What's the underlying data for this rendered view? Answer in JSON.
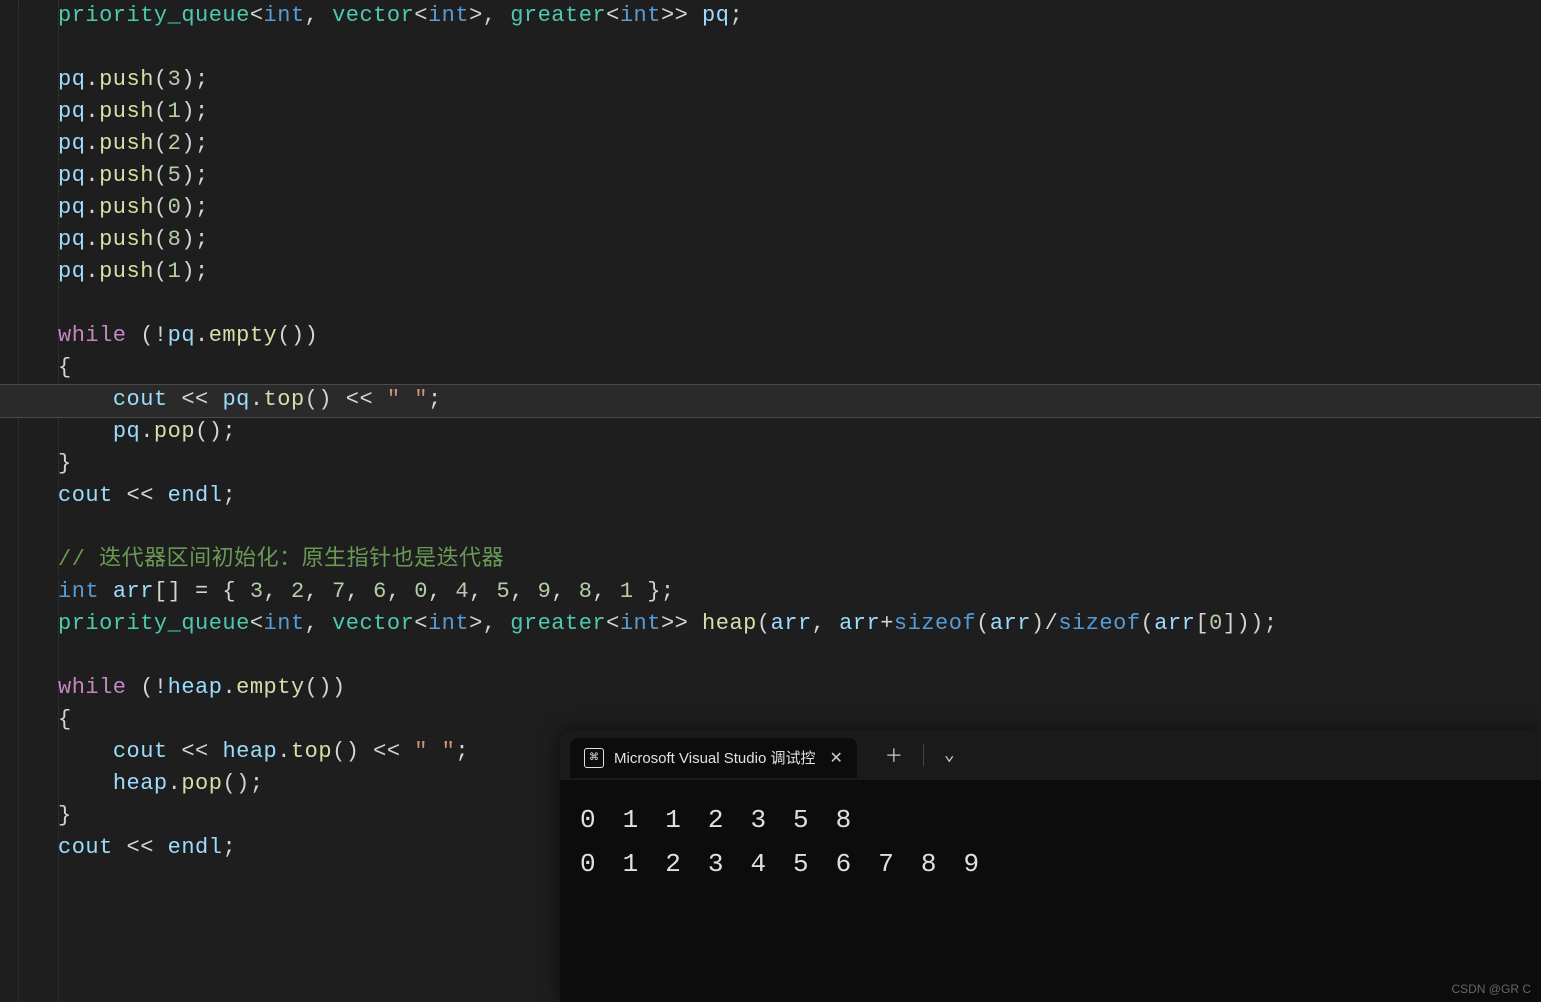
{
  "code_lines": [
    [
      {
        "cls": "t-type",
        "t": "priority_queue"
      },
      {
        "cls": "t-op",
        "t": "<"
      },
      {
        "cls": "t-key",
        "t": "int"
      },
      {
        "cls": "t-op",
        "t": ", "
      },
      {
        "cls": "t-type",
        "t": "vector"
      },
      {
        "cls": "t-op",
        "t": "<"
      },
      {
        "cls": "t-key",
        "t": "int"
      },
      {
        "cls": "t-op",
        "t": ">, "
      },
      {
        "cls": "t-type",
        "t": "greater"
      },
      {
        "cls": "t-op",
        "t": "<"
      },
      {
        "cls": "t-key",
        "t": "int"
      },
      {
        "cls": "t-op",
        "t": ">> "
      },
      {
        "cls": "t-var",
        "t": "pq"
      },
      {
        "cls": "t-op",
        "t": ";"
      }
    ],
    [],
    [
      {
        "cls": "t-var",
        "t": "pq"
      },
      {
        "cls": "t-op",
        "t": "."
      },
      {
        "cls": "t-fn",
        "t": "push"
      },
      {
        "cls": "t-op",
        "t": "("
      },
      {
        "cls": "t-num",
        "t": "3"
      },
      {
        "cls": "t-op",
        "t": ");"
      }
    ],
    [
      {
        "cls": "t-var",
        "t": "pq"
      },
      {
        "cls": "t-op",
        "t": "."
      },
      {
        "cls": "t-fn",
        "t": "push"
      },
      {
        "cls": "t-op",
        "t": "("
      },
      {
        "cls": "t-num",
        "t": "1"
      },
      {
        "cls": "t-op",
        "t": ");"
      }
    ],
    [
      {
        "cls": "t-var",
        "t": "pq"
      },
      {
        "cls": "t-op",
        "t": "."
      },
      {
        "cls": "t-fn",
        "t": "push"
      },
      {
        "cls": "t-op",
        "t": "("
      },
      {
        "cls": "t-num",
        "t": "2"
      },
      {
        "cls": "t-op",
        "t": ");"
      }
    ],
    [
      {
        "cls": "t-var",
        "t": "pq"
      },
      {
        "cls": "t-op",
        "t": "."
      },
      {
        "cls": "t-fn",
        "t": "push"
      },
      {
        "cls": "t-op",
        "t": "("
      },
      {
        "cls": "t-num",
        "t": "5"
      },
      {
        "cls": "t-op",
        "t": ");"
      }
    ],
    [
      {
        "cls": "t-var",
        "t": "pq"
      },
      {
        "cls": "t-op",
        "t": "."
      },
      {
        "cls": "t-fn",
        "t": "push"
      },
      {
        "cls": "t-op",
        "t": "("
      },
      {
        "cls": "t-num",
        "t": "0"
      },
      {
        "cls": "t-op",
        "t": ");"
      }
    ],
    [
      {
        "cls": "t-var",
        "t": "pq"
      },
      {
        "cls": "t-op",
        "t": "."
      },
      {
        "cls": "t-fn",
        "t": "push"
      },
      {
        "cls": "t-op",
        "t": "("
      },
      {
        "cls": "t-num",
        "t": "8"
      },
      {
        "cls": "t-op",
        "t": ");"
      }
    ],
    [
      {
        "cls": "t-var",
        "t": "pq"
      },
      {
        "cls": "t-op",
        "t": "."
      },
      {
        "cls": "t-fn",
        "t": "push"
      },
      {
        "cls": "t-op",
        "t": "("
      },
      {
        "cls": "t-num",
        "t": "1"
      },
      {
        "cls": "t-op",
        "t": ");"
      }
    ],
    [],
    [
      {
        "cls": "t-kw",
        "t": "while"
      },
      {
        "cls": "t-op",
        "t": " (!"
      },
      {
        "cls": "t-var",
        "t": "pq"
      },
      {
        "cls": "t-op",
        "t": "."
      },
      {
        "cls": "t-fn",
        "t": "empty"
      },
      {
        "cls": "t-op",
        "t": "())"
      }
    ],
    [
      {
        "cls": "t-op",
        "t": "{"
      }
    ],
    [
      {
        "cls": "t-op",
        "t": "    "
      },
      {
        "cls": "t-var",
        "t": "cout"
      },
      {
        "cls": "t-op",
        "t": " << "
      },
      {
        "cls": "t-var",
        "t": "pq"
      },
      {
        "cls": "t-op",
        "t": "."
      },
      {
        "cls": "t-fn",
        "t": "top"
      },
      {
        "cls": "t-op",
        "t": "() << "
      },
      {
        "cls": "t-str",
        "t": "\" \""
      },
      {
        "cls": "t-op",
        "t": ";"
      }
    ],
    [
      {
        "cls": "t-op",
        "t": "    "
      },
      {
        "cls": "t-var",
        "t": "pq"
      },
      {
        "cls": "t-op",
        "t": "."
      },
      {
        "cls": "t-fn",
        "t": "pop"
      },
      {
        "cls": "t-op",
        "t": "();"
      }
    ],
    [
      {
        "cls": "t-op",
        "t": "}"
      }
    ],
    [
      {
        "cls": "t-var",
        "t": "cout"
      },
      {
        "cls": "t-op",
        "t": " << "
      },
      {
        "cls": "t-var",
        "t": "endl"
      },
      {
        "cls": "t-op",
        "t": ";"
      }
    ],
    [],
    [
      {
        "cls": "t-com",
        "t": "// 迭代器区间初始化：原生指针也是迭代器"
      }
    ],
    [
      {
        "cls": "t-key",
        "t": "int"
      },
      {
        "cls": "t-op",
        "t": " "
      },
      {
        "cls": "t-var",
        "t": "arr"
      },
      {
        "cls": "t-op",
        "t": "[] = { "
      },
      {
        "cls": "t-num",
        "t": "3"
      },
      {
        "cls": "t-op",
        "t": ", "
      },
      {
        "cls": "t-num",
        "t": "2"
      },
      {
        "cls": "t-op",
        "t": ", "
      },
      {
        "cls": "t-num",
        "t": "7"
      },
      {
        "cls": "t-op",
        "t": ", "
      },
      {
        "cls": "t-num",
        "t": "6"
      },
      {
        "cls": "t-op",
        "t": ", "
      },
      {
        "cls": "t-num",
        "t": "0"
      },
      {
        "cls": "t-op",
        "t": ", "
      },
      {
        "cls": "t-num",
        "t": "4"
      },
      {
        "cls": "t-op",
        "t": ", "
      },
      {
        "cls": "t-num",
        "t": "5"
      },
      {
        "cls": "t-op",
        "t": ", "
      },
      {
        "cls": "t-num",
        "t": "9"
      },
      {
        "cls": "t-op",
        "t": ", "
      },
      {
        "cls": "t-num",
        "t": "8"
      },
      {
        "cls": "t-op",
        "t": ", "
      },
      {
        "cls": "t-num",
        "t": "1"
      },
      {
        "cls": "t-op",
        "t": " };"
      }
    ],
    [
      {
        "cls": "t-type",
        "t": "priority_queue"
      },
      {
        "cls": "t-op",
        "t": "<"
      },
      {
        "cls": "t-key",
        "t": "int"
      },
      {
        "cls": "t-op",
        "t": ", "
      },
      {
        "cls": "t-type",
        "t": "vector"
      },
      {
        "cls": "t-op",
        "t": "<"
      },
      {
        "cls": "t-key",
        "t": "int"
      },
      {
        "cls": "t-op",
        "t": ">, "
      },
      {
        "cls": "t-type",
        "t": "greater"
      },
      {
        "cls": "t-op",
        "t": "<"
      },
      {
        "cls": "t-key",
        "t": "int"
      },
      {
        "cls": "t-op",
        "t": ">> "
      },
      {
        "cls": "t-fn",
        "t": "heap"
      },
      {
        "cls": "t-op",
        "t": "("
      },
      {
        "cls": "t-var",
        "t": "arr"
      },
      {
        "cls": "t-op",
        "t": ", "
      },
      {
        "cls": "t-var",
        "t": "arr"
      },
      {
        "cls": "t-op",
        "t": "+"
      },
      {
        "cls": "t-key",
        "t": "sizeof"
      },
      {
        "cls": "t-op",
        "t": "("
      },
      {
        "cls": "t-var",
        "t": "arr"
      },
      {
        "cls": "t-op",
        "t": ")/"
      },
      {
        "cls": "t-key",
        "t": "sizeof"
      },
      {
        "cls": "t-op",
        "t": "("
      },
      {
        "cls": "t-var",
        "t": "arr"
      },
      {
        "cls": "t-op",
        "t": "["
      },
      {
        "cls": "t-num",
        "t": "0"
      },
      {
        "cls": "t-op",
        "t": "]));"
      }
    ],
    [],
    [
      {
        "cls": "t-kw",
        "t": "while"
      },
      {
        "cls": "t-op",
        "t": " (!"
      },
      {
        "cls": "t-var",
        "t": "heap"
      },
      {
        "cls": "t-op",
        "t": "."
      },
      {
        "cls": "t-fn",
        "t": "empty"
      },
      {
        "cls": "t-op",
        "t": "())"
      }
    ],
    [
      {
        "cls": "t-op",
        "t": "{"
      }
    ],
    [
      {
        "cls": "t-op",
        "t": "    "
      },
      {
        "cls": "t-var",
        "t": "cout"
      },
      {
        "cls": "t-op",
        "t": " << "
      },
      {
        "cls": "t-var",
        "t": "heap"
      },
      {
        "cls": "t-op",
        "t": "."
      },
      {
        "cls": "t-fn",
        "t": "top"
      },
      {
        "cls": "t-op",
        "t": "() << "
      },
      {
        "cls": "t-str",
        "t": "\" \""
      },
      {
        "cls": "t-op",
        "t": ";"
      }
    ],
    [
      {
        "cls": "t-op",
        "t": "    "
      },
      {
        "cls": "t-var",
        "t": "heap"
      },
      {
        "cls": "t-op",
        "t": "."
      },
      {
        "cls": "t-fn",
        "t": "pop"
      },
      {
        "cls": "t-op",
        "t": "();"
      }
    ],
    [
      {
        "cls": "t-op",
        "t": "}"
      }
    ],
    [
      {
        "cls": "t-var",
        "t": "cout"
      },
      {
        "cls": "t-op",
        "t": " << "
      },
      {
        "cls": "t-var",
        "t": "endl"
      },
      {
        "cls": "t-op",
        "t": ";"
      }
    ]
  ],
  "highlight_index": 12,
  "terminal": {
    "tab_title": "Microsoft Visual Studio 调试控",
    "tab_icon_glyph": "⌘",
    "close_glyph": "✕",
    "plus_glyph": "＋",
    "chevron_glyph": "⌄",
    "output_rows": [
      [
        "0",
        "1",
        "1",
        "2",
        "3",
        "5",
        "8"
      ],
      [
        "0",
        "1",
        "2",
        "3",
        "4",
        "5",
        "6",
        "7",
        "8",
        "9"
      ]
    ]
  },
  "watermark": "CSDN @GR C"
}
